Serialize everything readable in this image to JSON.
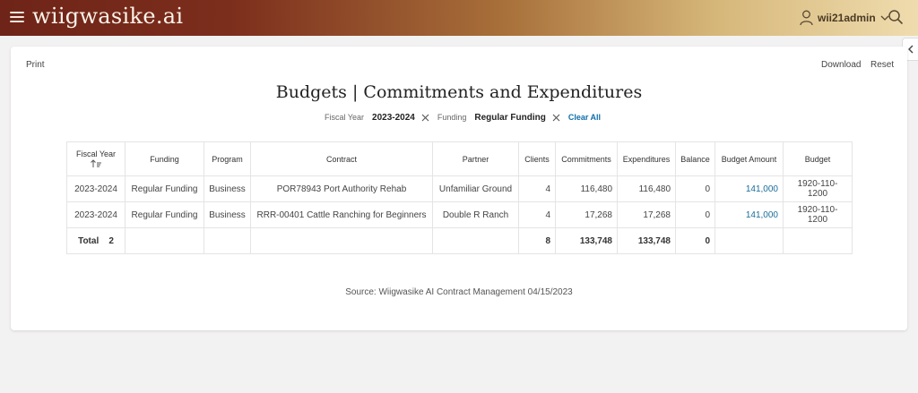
{
  "header": {
    "logo": "wiigwasike.ai",
    "username": "wii21admin"
  },
  "actions": {
    "print": "Print",
    "download": "Download",
    "reset": "Reset"
  },
  "page": {
    "title": "Budgets | Commitments and Expenditures"
  },
  "filters": {
    "fiscal_year_label": "Fiscal Year",
    "fiscal_year_value": "2023-2024",
    "funding_label": "Funding",
    "funding_value": "Regular Funding",
    "clear_all": "Clear All"
  },
  "table": {
    "columns": [
      "Fiscal Year",
      "Funding",
      "Program",
      "Contract",
      "Partner",
      "Clients",
      "Commitments",
      "Expenditures",
      "Balance",
      "Budget Amount",
      "Budget"
    ],
    "rows": [
      [
        "2023-2024",
        "Regular Funding",
        "Business",
        "POR78943 Port Authority Rehab",
        "Unfamiliar Ground",
        "4",
        "116,480",
        "116,480",
        "0",
        "141,000",
        "1920-110-1200"
      ],
      [
        "2023-2024",
        "Regular Funding",
        "Business",
        "RRR-00401 Cattle Ranching for Beginners",
        "Double R Ranch",
        "4",
        "17,268",
        "17,268",
        "0",
        "141,000",
        "1920-110-1200"
      ]
    ],
    "total": {
      "label": "Total",
      "count": "2",
      "clients": "8",
      "commitments": "133,748",
      "expenditures": "133,748",
      "balance": "0"
    }
  },
  "source": "Source: Wiigwasike AI Contract Management 04/15/2023",
  "colors": {
    "header_start": "#6e2418",
    "header_end": "#efdcae",
    "link": "#1a6e99",
    "clear_all": "#0e6ea8"
  },
  "icons": [
    "hamburger-icon",
    "user-icon",
    "chevron-down-icon",
    "search-icon",
    "chevron-left-icon",
    "close-icon",
    "sort-ascending-icon"
  ]
}
